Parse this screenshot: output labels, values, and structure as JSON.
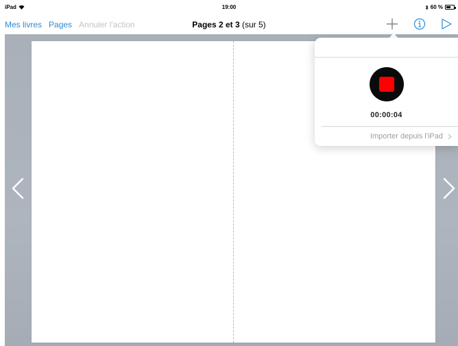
{
  "status_bar": {
    "device": "iPad",
    "time": "19:00",
    "battery": "60 %",
    "battery_level": 0.6
  },
  "nav": {
    "my_books": "Mes livres",
    "pages": "Pages",
    "undo": "Annuler l'action",
    "title_bold": "Pages 2 et 3",
    "title_rest": " (sur 5)",
    "icons": [
      "plus-icon",
      "info-icon",
      "play-icon"
    ]
  },
  "popover": {
    "timer": "00:00:04",
    "import_label": "Importer depuis l'iPad",
    "record_color": "#fe0000"
  },
  "colors": {
    "accent": "#2b8bd6",
    "canvas": "#aab1bb"
  }
}
